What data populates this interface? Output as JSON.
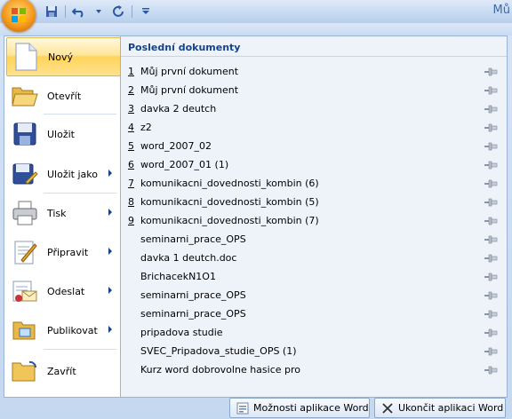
{
  "window": {
    "title_fragment": "Mů"
  },
  "quick_access": [
    "save-icon",
    "undo-icon",
    "redo-icon",
    "customize-icon"
  ],
  "left_menu": [
    {
      "label": "Nový",
      "icon": "new-document-icon",
      "arrow": false,
      "active": true
    },
    {
      "label": "Otevřít",
      "icon": "open-folder-icon",
      "arrow": false
    },
    {
      "label": "Uložit",
      "icon": "save-disk-icon",
      "arrow": false
    },
    {
      "label": "Uložit jako",
      "icon": "save-as-icon",
      "arrow": true
    },
    {
      "label": "Tisk",
      "icon": "printer-icon",
      "arrow": true
    },
    {
      "label": "Připravit",
      "icon": "prepare-icon",
      "arrow": true
    },
    {
      "label": "Odeslat",
      "icon": "send-icon",
      "arrow": true
    },
    {
      "label": "Publikovat",
      "icon": "publish-icon",
      "arrow": true
    },
    {
      "label": "Zavřít",
      "icon": "close-folder-icon",
      "arrow": false
    }
  ],
  "recent": {
    "title": "Poslední dokumenty",
    "items": [
      {
        "num": "1",
        "name": "Můj první dokument"
      },
      {
        "num": "2",
        "name": "Můj první dokument"
      },
      {
        "num": "3",
        "name": "davka 2 deutch"
      },
      {
        "num": "4",
        "name": "z2"
      },
      {
        "num": "5",
        "name": "word_2007_02"
      },
      {
        "num": "6",
        "name": "word_2007_01 (1)"
      },
      {
        "num": "7",
        "name": "komunikacni_dovednosti_kombin (6)"
      },
      {
        "num": "8",
        "name": "komunikacni_dovednosti_kombin (5)"
      },
      {
        "num": "9",
        "name": "komunikacni_dovednosti_kombin (7)"
      },
      {
        "num": "",
        "name": "seminarni_prace_OPS"
      },
      {
        "num": "",
        "name": "davka 1 deutch.doc"
      },
      {
        "num": "",
        "name": "BrichacekN1O1"
      },
      {
        "num": "",
        "name": "seminarni_prace_OPS"
      },
      {
        "num": "",
        "name": "seminarni_prace_OPS"
      },
      {
        "num": "",
        "name": "pripadova studie"
      },
      {
        "num": "",
        "name": "SVEC_Pripadova_studie_OPS (1)"
      },
      {
        "num": "",
        "name": "Kurz word dobrovolne hasice pro"
      }
    ]
  },
  "bottom": {
    "options_label": "Možnosti aplikace Word",
    "exit_label": "Ukončit aplikaci Word"
  }
}
